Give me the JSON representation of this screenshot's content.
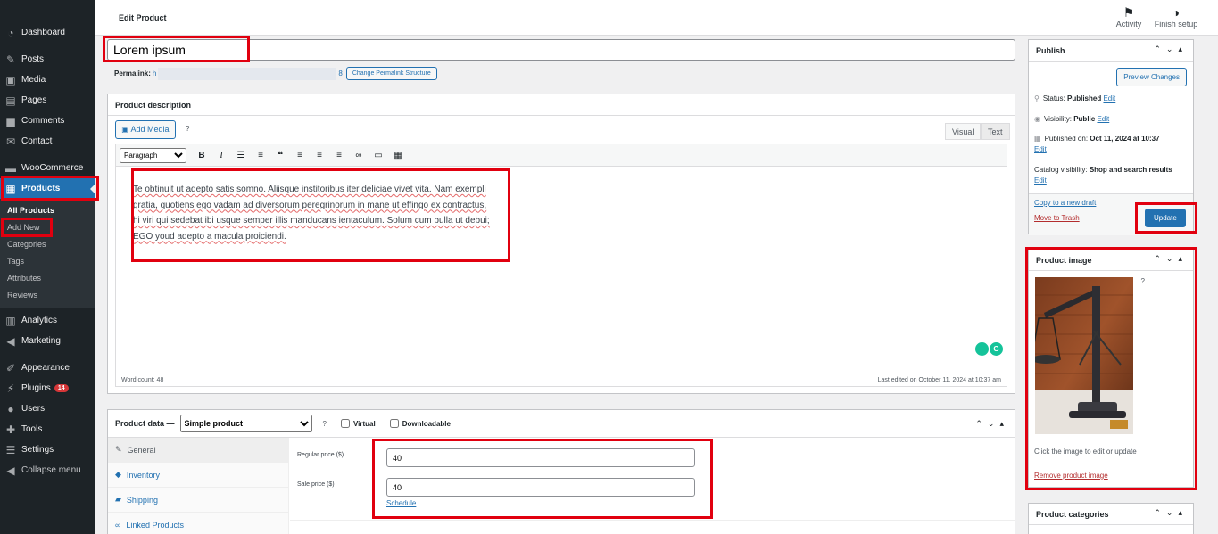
{
  "sidebar": {
    "items": [
      {
        "label": "Dashboard",
        "icon": "dashboard-icon",
        "glyph": "◔"
      },
      {
        "label": "Posts",
        "icon": "pin-icon",
        "glyph": "✎"
      },
      {
        "label": "Media",
        "icon": "media-icon",
        "glyph": "▣"
      },
      {
        "label": "Pages",
        "icon": "pages-icon",
        "glyph": "▤"
      },
      {
        "label": "Comments",
        "icon": "comment-icon",
        "glyph": "▆"
      },
      {
        "label": "Contact",
        "icon": "envelope-icon",
        "glyph": "✉"
      },
      {
        "label": "WooCommerce",
        "icon": "woo-icon",
        "glyph": "▬"
      },
      {
        "label": "Products",
        "icon": "archive-icon",
        "glyph": "▦"
      },
      {
        "label": "Analytics",
        "icon": "bar-chart-icon",
        "glyph": "▥"
      },
      {
        "label": "Marketing",
        "icon": "megaphone-icon",
        "glyph": "◀"
      },
      {
        "label": "Appearance",
        "icon": "brush-icon",
        "glyph": "✐"
      },
      {
        "label": "Plugins",
        "icon": "plug-icon",
        "glyph": "⚡",
        "badge": "14"
      },
      {
        "label": "Users",
        "icon": "users-icon",
        "glyph": "●"
      },
      {
        "label": "Tools",
        "icon": "wrench-icon",
        "glyph": "✚"
      },
      {
        "label": "Settings",
        "icon": "settings-icon",
        "glyph": "☰"
      },
      {
        "label": "Collapse menu",
        "icon": "collapse-icon",
        "glyph": "◀"
      }
    ],
    "submenu": [
      "All Products",
      "Add New",
      "Categories",
      "Tags",
      "Attributes",
      "Reviews"
    ]
  },
  "header": {
    "title": "Edit Product",
    "activity": "Activity",
    "finish_setup": "Finish setup"
  },
  "title_field": {
    "value": "Lorem ipsum"
  },
  "permalink": {
    "label": "Permalink:",
    "link_start": "h",
    "link_end": "8",
    "change_button": "Change Permalink Structure"
  },
  "description": {
    "heading": "Product description",
    "add_media": "Add Media",
    "help": "?",
    "tab_visual": "Visual",
    "tab_text": "Text",
    "format_select": "Paragraph",
    "content": "Te obtinuit ut adepto satis somno. Aliisque institoribus iter deliciae vivet vita. Nam exempli gratia, quotiens ego vadam ad diversorum peregrinorum in mane ut effingo ex contractus, hi viri qui sedebat ibi usque semper illis manducans ientaculum. Solum cum bulla ut debui; EGO youd adepto a macula proiciendi.",
    "word_count": "Word count: 48",
    "last_edited": "Last edited on October 11, 2024 at 10:37 am"
  },
  "product_data": {
    "label": "Product data —",
    "type": "Simple product",
    "help": "?",
    "virtual": "Virtual",
    "downloadable": "Downloadable",
    "tabs": [
      {
        "label": "General",
        "icon": "wrench-icon",
        "glyph": "✎"
      },
      {
        "label": "Inventory",
        "icon": "tag-icon",
        "glyph": "◆"
      },
      {
        "label": "Shipping",
        "icon": "truck-icon",
        "glyph": "▰"
      },
      {
        "label": "Linked Products",
        "icon": "link-icon",
        "glyph": "∞"
      }
    ],
    "regular_price_label": "Regular price ($)",
    "regular_price": "40",
    "sale_price_label": "Sale price ($)",
    "sale_price": "40",
    "schedule": "Schedule"
  },
  "publish": {
    "heading": "Publish",
    "preview": "Preview Changes",
    "status_label": "Status:",
    "status_value": "Published",
    "visibility_label": "Visibility:",
    "visibility_value": "Public",
    "published_label": "Published on:",
    "published_value": "Oct 11, 2024 at 10:37",
    "catalog_label": "Catalog visibility:",
    "catalog_value": "Shop and search results",
    "edit": "Edit",
    "copy_draft": "Copy to a new draft",
    "trash": "Move to Trash",
    "update": "Update"
  },
  "product_image": {
    "heading": "Product image",
    "help": "?",
    "hint": "Click the image to edit or update",
    "remove": "Remove product image"
  },
  "product_categories": {
    "heading": "Product categories"
  },
  "colors": {
    "accent": "#2271b1",
    "highlight": "#e1000f",
    "sidebar": "#1d2327"
  }
}
